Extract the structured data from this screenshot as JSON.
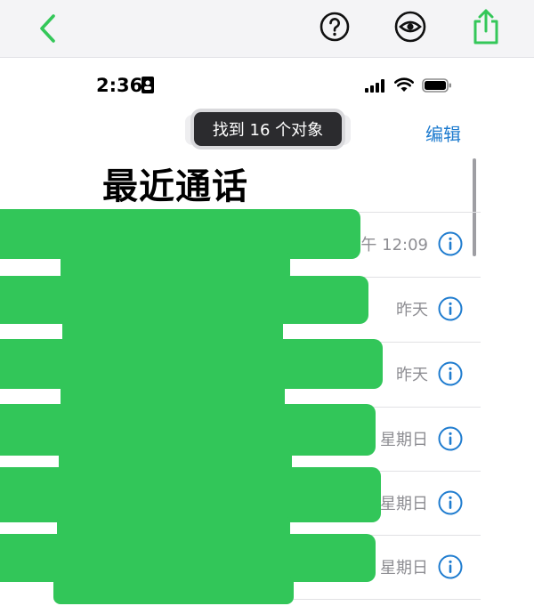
{
  "toolbar": {
    "icons": [
      "chevron-left-icon",
      "help-icon",
      "eye-icon",
      "share-icon"
    ],
    "accent_color": "#34c759"
  },
  "status_bar": {
    "time": "2:36"
  },
  "find_toast": {
    "text": "找到 16 个对象"
  },
  "header": {
    "edit_label": "编辑",
    "title": "最近通话"
  },
  "calls": [
    {
      "time": "下午 12:09"
    },
    {
      "time": "昨天"
    },
    {
      "time": "昨天"
    },
    {
      "time": "星期日"
    },
    {
      "time": "星期日"
    },
    {
      "time": "星期日"
    }
  ],
  "colors": {
    "link_blue": "#1f7ccf",
    "redaction_green": "#32c659",
    "secondary_text": "#8e8e93"
  }
}
